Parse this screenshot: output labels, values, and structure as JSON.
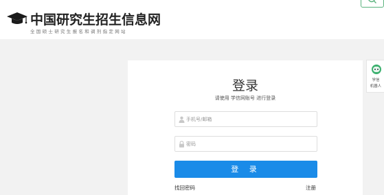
{
  "header": {
    "site_title": "中国研究生招生信息网",
    "site_subtitle": "全国硕士研究生报名和调剂指定网站"
  },
  "login": {
    "title": "登录",
    "hint": "请使用 学信网账号 进行登录",
    "username_placeholder": "手机号/邮箱",
    "password_placeholder": "密码",
    "submit_label": "登 录",
    "forgot_label": "找回密码",
    "register_label": "注册"
  },
  "side_widget": {
    "line1": "学信",
    "line2": "机器人"
  },
  "colors": {
    "primary": "#1a8be8",
    "robot": "#3bb06e",
    "page_bg": "#f2f2f2"
  }
}
